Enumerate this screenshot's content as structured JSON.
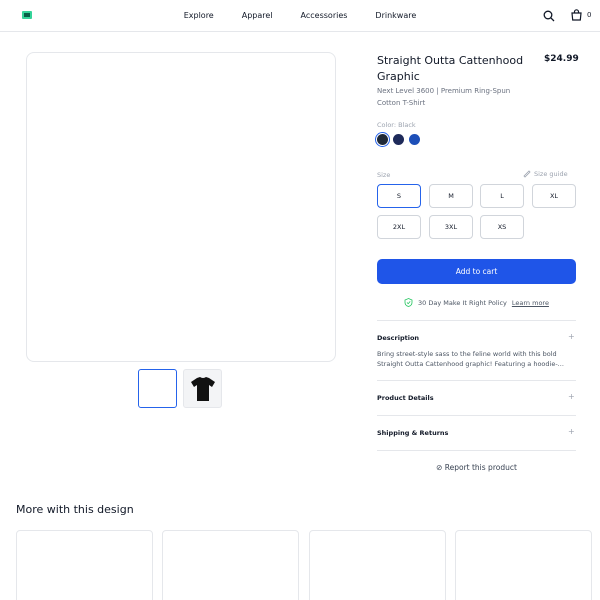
{
  "header": {
    "logo": "logo-icon",
    "nav": [
      "Explore",
      "Apparel",
      "Accessories",
      "Drinkware"
    ],
    "cart_count": "0"
  },
  "product": {
    "title": "Straight Outta Cattenhood Graphic",
    "price": "$24.99",
    "subtitle": "Next Level 3600 | Premium Ring-Spun Cotton T-Shirt",
    "color_label": "Color: Black",
    "colors": [
      "#1f2937",
      "#1e2a5a",
      "#1d4fb8"
    ],
    "size_label": "Size",
    "size_guide": "Size guide",
    "sizes": [
      "S",
      "M",
      "L",
      "XL",
      "2XL",
      "3XL",
      "XS"
    ],
    "add_to_cart": "Add to cart",
    "policy_text": "30 Day Make It Right Policy",
    "policy_link": "Learn more"
  },
  "accordion": {
    "description_title": "Description",
    "description_text": "Bring street-style sass to the feline world with this bold Straight Outta Cattenhood graphic! Featuring a hoodie-...",
    "details_title": "Product Details",
    "shipping_title": "Shipping & Returns",
    "plus": "+"
  },
  "report": "⊘ Report this product",
  "more": {
    "title": "More with this design"
  },
  "colors": {
    "accent": "#1f55e8",
    "border": "#e5e7eb"
  }
}
